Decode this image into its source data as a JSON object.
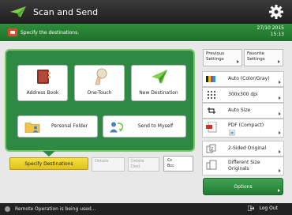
{
  "header": {
    "title": "Scan and Send",
    "icon": "send-plane-icon",
    "settings_icon": "gear-icon"
  },
  "status": {
    "message": "Specify the destinations.",
    "date": "27/10 2015",
    "time": "15:13"
  },
  "tiles": [
    {
      "label": "Address Book",
      "icon": "address-book-icon"
    },
    {
      "label": "One-Touch",
      "icon": "one-touch-icon"
    },
    {
      "label": "New Destination",
      "icon": "new-destination-icon"
    },
    {
      "label": "Personal Folder",
      "icon": "folder-icon"
    },
    {
      "label": "Send to Myself",
      "icon": "send-to-myself-icon"
    }
  ],
  "bottom": {
    "specify": "Specify Destinations",
    "details": "Details",
    "delete_line1": "Delete",
    "delete_line2": "Dest.",
    "cc_line1": "Cc",
    "cc_line2": "Bcc"
  },
  "right": {
    "previous_line1": "Previous",
    "previous_line2": "Settings",
    "favorite_line1": "Favorite",
    "favorite_line2": "Settings",
    "color": "Auto (Color/Gray)",
    "resolution": "300x300 dpi",
    "size": "Auto Size",
    "format_line1": "PDF (Compact)",
    "duplex": "2-Sided Original",
    "mixed_line1": "Different Size",
    "mixed_line2": "Originals",
    "options": "Options"
  },
  "footer": {
    "message": "Remote Operation is being used...",
    "logout": "Log Out"
  },
  "colors": {
    "green": "#2e8a43",
    "yellow": "#f6df40",
    "header": "#1e1e1e"
  }
}
